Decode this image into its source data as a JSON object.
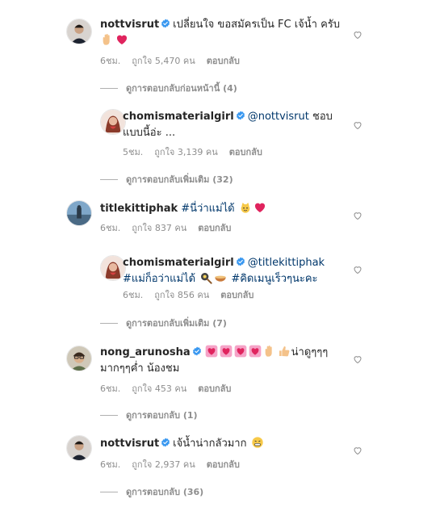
{
  "comments": [
    {
      "username": "nottvisrut",
      "text": "เปลี่ยนใจ ขอสมัครเป็น FC เจ้น้ำ ครับ",
      "time": "6ชม.",
      "likes": "ถูกใจ 5,470 คน",
      "reply": "ตอบกลับ",
      "thread_toggle": "ดูการตอบกลับก่อนหน้านี้ (4)"
    },
    {
      "username": "chomismaterialgirl",
      "mention": "@nottvisrut",
      "text_line1": "ชอบ",
      "text_line2": "แบบนี้อ่ะ ...",
      "time": "5ชม.",
      "likes": "ถูกใจ 3,139 คน",
      "reply": "ตอบกลับ",
      "thread_toggle": "ดูการตอบกลับเพิ่มเติม (32)"
    },
    {
      "username": "titlekittiphak",
      "hashtag": "#นี่ว่าแม่ได้",
      "time": "6ชม.",
      "likes": "ถูกใจ 837 คน",
      "reply": "ตอบกลับ"
    },
    {
      "username": "chomismaterialgirl",
      "mention": "@titlekittiphak",
      "hashtag1": "#แม่ก็อว่าแม่ได้",
      "hashtag2": "#คิดเมนูเร็วๆนะคะ",
      "time": "6ชม.",
      "likes": "ถูกใจ 856 คน",
      "reply": "ตอบกลับ",
      "thread_toggle": "ดูการตอบกลับเพิ่มเติม (7)"
    },
    {
      "username": "nong_arunosha",
      "text_line1": "น่าดูๆๆๆ",
      "text_line2": "มากๆๆค่ำ น้องชม",
      "time": "6ชม.",
      "likes": "ถูกใจ 453 คน",
      "reply": "ตอบกลับ",
      "thread_toggle": "ดูการตอบกลับ (1)"
    },
    {
      "username": "nottvisrut",
      "text": "เจ้น้ำน่ากลัวมาก",
      "time": "6ชม.",
      "likes": "ถูกใจ 2,937 คน",
      "reply": "ตอบกลับ",
      "thread_toggle": "ดูการตอบกลับ (36)"
    }
  ],
  "colors": {
    "verified": "#3897f0",
    "heart_red": "#ed4956",
    "meta_gray": "#8e8e8e",
    "link_blue": "#00376b"
  }
}
